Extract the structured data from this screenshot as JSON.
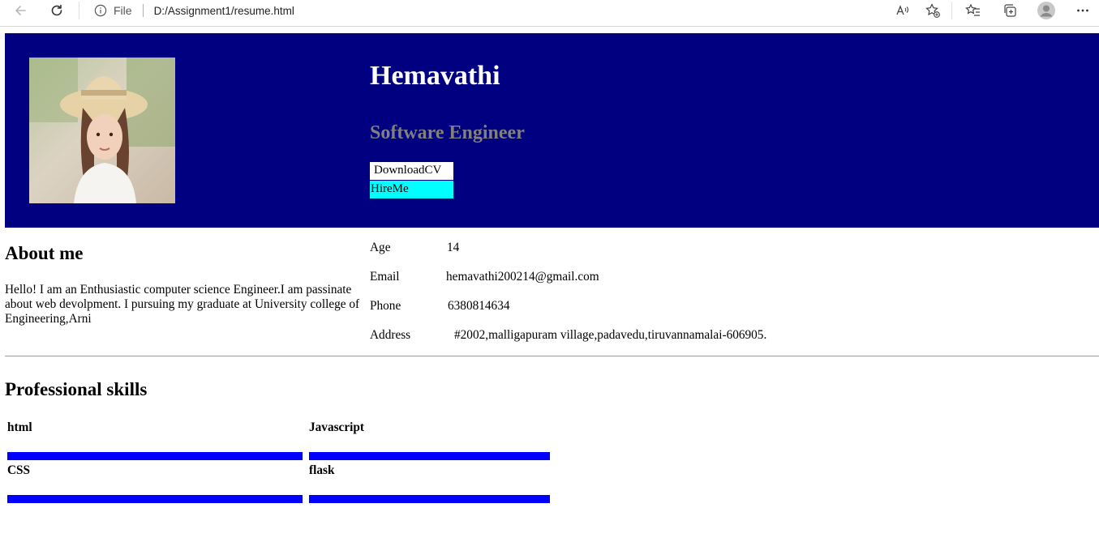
{
  "browser": {
    "scheme_label": "File",
    "url": "D:/Assignment1/resume.html"
  },
  "profile": {
    "name": "Hemavathi",
    "role": "Software Engineer",
    "download_label": "DownloadCV",
    "hire_label": "HireMe"
  },
  "about": {
    "title": "About me",
    "text": "Hello! I am an Enthusiastic computer science Engineer.I am passinate about web devolpment. I pursuing my graduate at University college of Engineering,Arni"
  },
  "details": [
    {
      "label": "Age",
      "value": "14"
    },
    {
      "label": "Email",
      "value": "hemavathi200214@gmail.com"
    },
    {
      "label": "Phone",
      "value": "6380814634"
    },
    {
      "label": "Address",
      "value": "#2002,malligapuram village,padavedu,tiruvannamalai-606905."
    }
  ],
  "skills": {
    "title": "Professional skills",
    "items": [
      {
        "name": "html"
      },
      {
        "name": "Javascript"
      },
      {
        "name": "CSS"
      },
      {
        "name": "flask"
      }
    ]
  },
  "colors": {
    "header_bg": "#000080",
    "hire_bg": "#00ffff",
    "skill_bar": "#0000ff",
    "role_text": "#808080"
  }
}
